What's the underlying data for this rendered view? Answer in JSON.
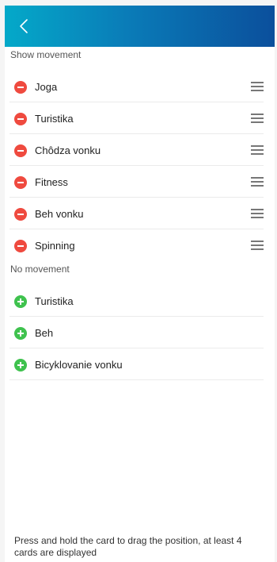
{
  "header": {
    "back_icon": "chevron-left-icon",
    "colors": {
      "gradient_start": "#04a9c9",
      "gradient_end": "#0b4f9c"
    }
  },
  "sections": {
    "show": {
      "title": "Show movement",
      "items": [
        {
          "label": "Joga"
        },
        {
          "label": "Turistika"
        },
        {
          "label": "Chôdza vonku"
        },
        {
          "label": "Fitness"
        },
        {
          "label": "Beh vonku"
        },
        {
          "label": "Spinning"
        }
      ]
    },
    "hidden": {
      "title": "No movement",
      "items": [
        {
          "label": "Turistika"
        },
        {
          "label": "Beh"
        },
        {
          "label": "Bicyklovanie vonku"
        }
      ]
    }
  },
  "icons": {
    "remove": "remove-circle-icon",
    "add": "add-circle-icon",
    "drag": "drag-handle-icon"
  },
  "colors": {
    "remove": "#ef4a3f",
    "add": "#3fc24e"
  },
  "footer": {
    "hint": "Press and hold the card to drag the position, at least 4 cards are displayed"
  }
}
